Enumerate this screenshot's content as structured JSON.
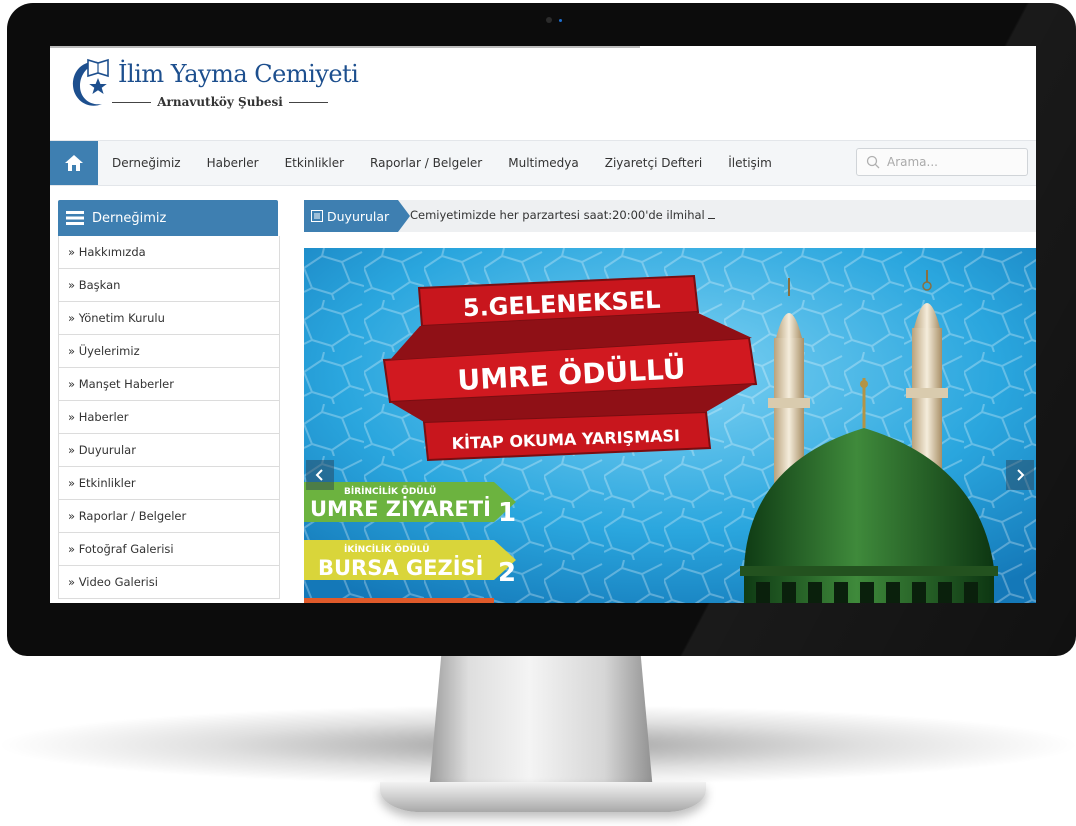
{
  "site": {
    "title": "İlim Yayma Cemiyeti",
    "subtitle": "Arnavutköy Şubesi"
  },
  "nav": {
    "items": [
      "Derneğimiz",
      "Haberler",
      "Etkinlikler",
      "Raporlar / Belgeler",
      "Multimedya",
      "Ziyaretçi Defteri",
      "İletişim"
    ],
    "search_placeholder": "Arama..."
  },
  "sidebar": {
    "title": "Derneğimiz",
    "items": [
      "» Hakkımızda",
      "» Başkan",
      "» Yönetim Kurulu",
      "» Üyelerimiz",
      "» Manşet Haberler",
      "» Haberler",
      "» Duyurular",
      "» Etkinlikler",
      "» Raporlar / Belgeler",
      "» Fotoğraf Galerisi",
      "» Video Galerisi"
    ]
  },
  "announcements": {
    "label": "Duyurular",
    "text": "Cemiyetimizde her parzartesi saat:20:00'de ilmihal"
  },
  "slider": {
    "line1": "5.GELENEKSEL",
    "line2": "UMRE ÖDÜLLÜ",
    "line3": "KİTAP OKUMA YARIŞMASI",
    "prize1_caption": "BİRİNCİLİK ÖDÜLÜ",
    "prize1_title": "UMRE ZİYARETİ",
    "prize1_rank": "1",
    "prize2_caption": "İKİNCİLİK ÖDÜLÜ",
    "prize2_title": "BURSA GEZİSİ",
    "prize2_rank": "2"
  },
  "colors": {
    "brand_blue": "#3e7fb1",
    "banner_red": "#c8161d",
    "prize1_green": "#6cb33f",
    "prize2_yellow": "#d9d53a",
    "dome_green": "#2f6b2f",
    "sky_blue": "#29a8e0"
  }
}
